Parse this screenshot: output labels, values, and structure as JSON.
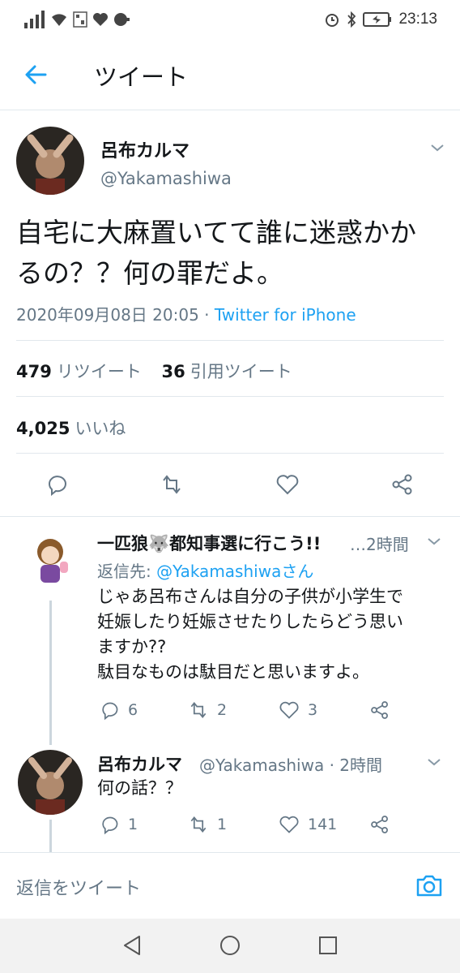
{
  "status_bar": {
    "time": "23:13"
  },
  "header": {
    "title": "ツイート"
  },
  "tweet": {
    "author_name": "呂布カルマ",
    "author_handle": "@Yakamashiwa",
    "text_line1": "自宅に大麻置いてて誰に迷惑かか",
    "text_line2": "るの？？何の罪だよ。",
    "timestamp": "2020年09月08日 20:05",
    "separator": " · ",
    "source": "Twitter for iPhone",
    "retweets_count": "479",
    "retweets_label": "リツイート",
    "quotes_count": "36",
    "quotes_label": "引用ツイート",
    "likes_count": "4,025",
    "likes_label": "いいね"
  },
  "replies": [
    {
      "author_name": "一匹狼🐺都知事選に行こう!!",
      "meta": "…2時間",
      "reply_to_prefix": "返信先: ",
      "reply_to_mention": "@Yakamashiwa",
      "reply_to_suffix": "さん",
      "text_lines": [
        "じゃあ呂布さんは自分の子供が小学生で",
        "妊娠したり妊娠させたりしたらどう思い",
        "ますか??",
        "駄目なものは駄目だと思いますよ。"
      ],
      "replies": "6",
      "retweets": "2",
      "likes": "3"
    },
    {
      "author_name": "呂布カルマ",
      "meta": "@Yakamashiwa · 2時間",
      "text_lines": [
        "何の話？？"
      ],
      "replies": "1",
      "retweets": "1",
      "likes": "141"
    }
  ],
  "compose": {
    "placeholder": "返信をツイート"
  },
  "colors": {
    "accent": "#1da1f2",
    "secondary_text": "#657786",
    "border": "#e1e8ed"
  }
}
